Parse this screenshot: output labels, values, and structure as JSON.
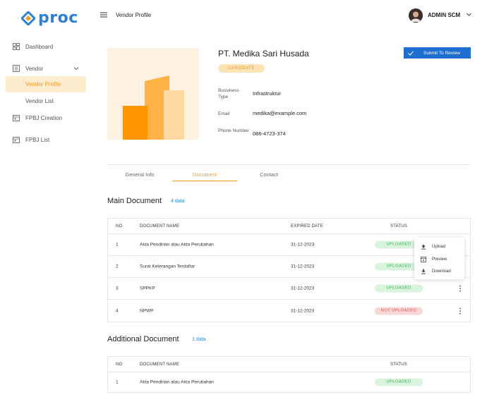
{
  "brand": {
    "name": "proc",
    "color": "#2d7fd8",
    "accent": "#f39a1f"
  },
  "sidebar": {
    "items": [
      {
        "label": "Dashboard",
        "icon": "dashboard-icon"
      },
      {
        "label": "Vendor",
        "icon": "vendor-icon",
        "expanded": true
      },
      {
        "label": "FPBJ Creation",
        "icon": "calendar-icon"
      },
      {
        "label": "FPBJ List",
        "icon": "calendar-icon"
      }
    ],
    "sub_items": [
      {
        "label": "Vendor Profile",
        "active": true
      },
      {
        "label": "Vendor List",
        "active": false
      }
    ]
  },
  "header": {
    "title": "Vendor Profile",
    "user_name": "ADMIN SCM"
  },
  "profile": {
    "company_name": "PT. Medika Sari Husada",
    "status_badge": "CANDIDATE",
    "submit_label": "Submit To Review",
    "fields": [
      {
        "label": "Bussiness Type",
        "value": "Infrastruktur"
      },
      {
        "label": "Email",
        "value": "medika@example.com"
      },
      {
        "label": "Phone Number",
        "value": "086-4723-374"
      }
    ]
  },
  "tabs": [
    {
      "label": "General Info",
      "active": false
    },
    {
      "label": "Document",
      "active": true
    },
    {
      "label": "Contact",
      "active": false
    }
  ],
  "main_document": {
    "title": "Main Document",
    "count": "4 data",
    "columns": [
      "NO",
      "DOCUMENT NAME",
      "EXPIRED DATE",
      "STATUS"
    ],
    "rows": [
      {
        "no": "1",
        "name": "Akta Pendirian atau Akta Perubahan",
        "date": "31-12-2023",
        "status": "UPLOADED"
      },
      {
        "no": "2",
        "name": "Surat Keterangan Terdaftar",
        "date": "31-12-2023",
        "status": "UPLOADED"
      },
      {
        "no": "3",
        "name": "SPPKP",
        "date": "31-12-2023",
        "status": "UPLOADED"
      },
      {
        "no": "4",
        "name": "NPWP",
        "date": "31-12-2023",
        "status": "NOT UPLOADED"
      }
    ]
  },
  "row_menu": {
    "items": [
      "Upload",
      "Preview",
      "Download"
    ]
  },
  "additional_document": {
    "title": "Additional Document",
    "count": "1 data",
    "columns": [
      "NO",
      "DOCUMENT NAME",
      "STATUS"
    ],
    "rows": [
      {
        "no": "1",
        "name": "Akta Pendirian atau Akta Perubahan",
        "status": "UPLOADED"
      }
    ]
  }
}
